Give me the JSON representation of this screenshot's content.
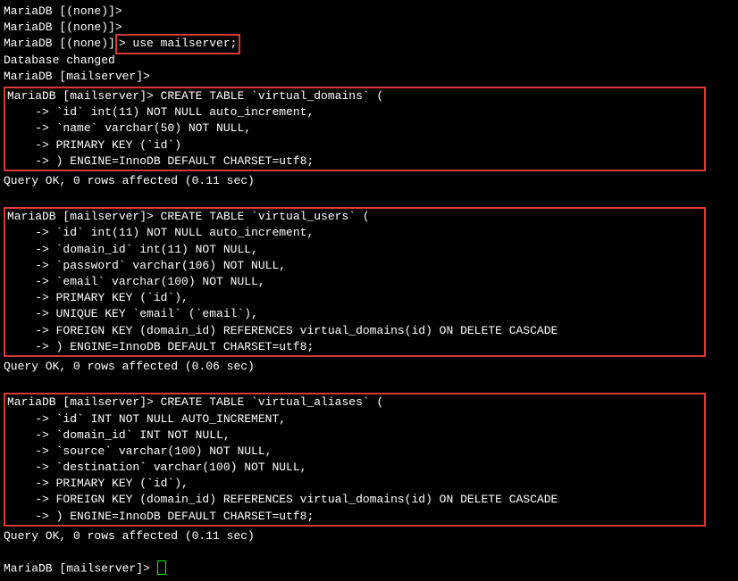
{
  "lines": {
    "p1": "MariaDB [(none)]>",
    "p2": "MariaDB [(none)]>",
    "p3a": "MariaDB [(none)]",
    "p3b": "> use mailserver;",
    "dbchanged": "Database changed",
    "p4": "MariaDB [mailserver]>",
    "block1": {
      "l1": "MariaDB [mailserver]> CREATE TABLE `virtual_domains` (",
      "l2": "    -> `id` int(11) NOT NULL auto_increment,",
      "l3": "    -> `name` varchar(50) NOT NULL,",
      "l4": "    -> PRIMARY KEY (`id`)",
      "l5": "    -> ) ENGINE=InnoDB DEFAULT CHARSET=utf8;"
    },
    "r1": "Query OK, 0 rows affected (0.11 sec)",
    "blank1": " ",
    "block2": {
      "l1": "MariaDB [mailserver]> CREATE TABLE `virtual_users` (",
      "l2": "    -> `id` int(11) NOT NULL auto_increment,",
      "l3": "    -> `domain_id` int(11) NOT NULL,",
      "l4": "    -> `password` varchar(106) NOT NULL,",
      "l5": "    -> `email` varchar(100) NOT NULL,",
      "l6": "    -> PRIMARY KEY (`id`),",
      "l7": "    -> UNIQUE KEY `email` (`email`),",
      "l8": "    -> FOREIGN KEY (domain_id) REFERENCES virtual_domains(id) ON DELETE CASCADE",
      "l9": "    -> ) ENGINE=InnoDB DEFAULT CHARSET=utf8;"
    },
    "r2": "Query OK, 0 rows affected (0.06 sec)",
    "blank2": " ",
    "block3": {
      "l1": "MariaDB [mailserver]> CREATE TABLE `virtual_aliases` (",
      "l2": "    -> `id` INT NOT NULL AUTO_INCREMENT,",
      "l3": "    -> `domain_id` INT NOT NULL,",
      "l4": "    -> `source` varchar(100) NOT NULL,",
      "l5": "    -> `destination` varchar(100) NOT NULL,",
      "l6": "    -> PRIMARY KEY (`id`),",
      "l7": "    -> FOREIGN KEY (domain_id) REFERENCES virtual_domains(id) ON DELETE CASCADE",
      "l8": "    -> ) ENGINE=InnoDB DEFAULT CHARSET=utf8;"
    },
    "r3": "Query OK, 0 rows affected (0.11 sec)",
    "blank3": " ",
    "p5": "MariaDB [mailserver]> "
  }
}
